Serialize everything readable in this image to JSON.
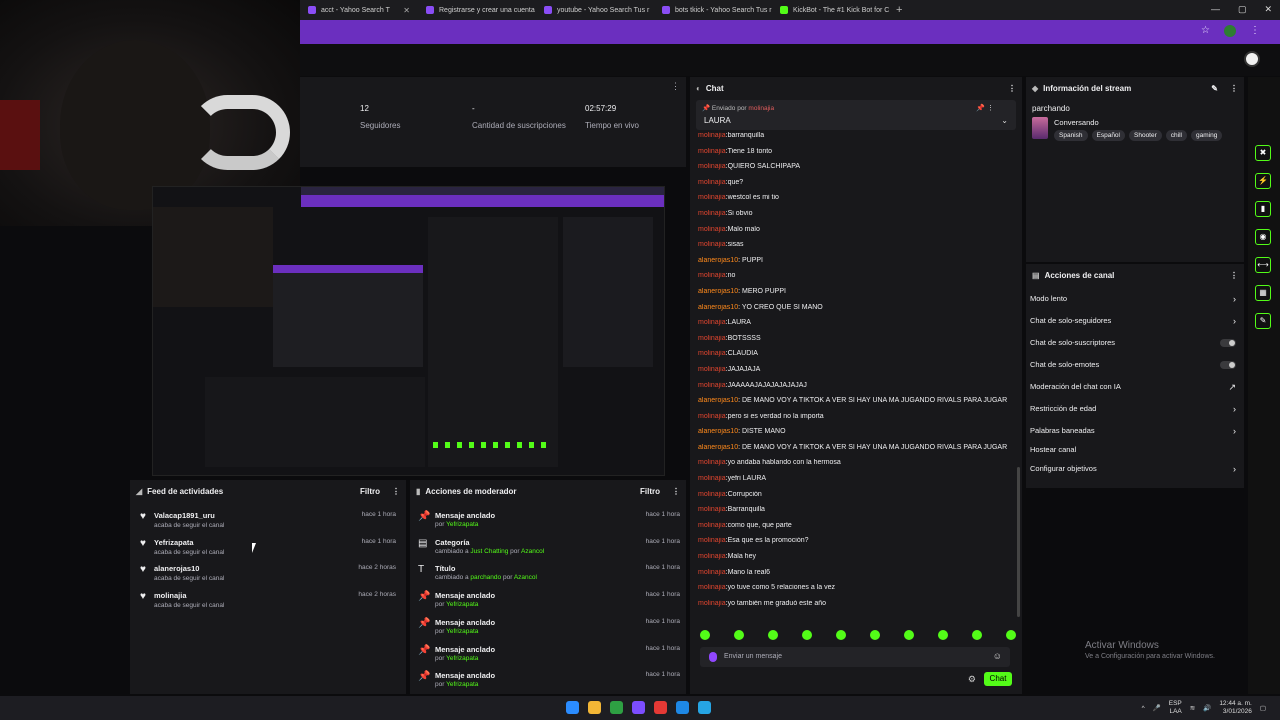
{
  "browser": {
    "tabs": [
      {
        "label": "acct - Yahoo Search T"
      },
      {
        "label": "Registrarse y crear una cuenta"
      },
      {
        "label": "youtube - Yahoo Search Tus r"
      },
      {
        "label": "bots tkick - Yahoo Search Tus r"
      },
      {
        "label": "KickBot - The #1 Kick Bot for C"
      }
    ],
    "new_tab": "+",
    "window_controls": [
      "—",
      "▢",
      "✕"
    ]
  },
  "stats": [
    {
      "value": "12",
      "label": "Seguidores"
    },
    {
      "value": "-",
      "label": "Cantidad de suscripciones"
    },
    {
      "value": "02:57:29",
      "label": "Tiempo en vivo"
    }
  ],
  "activity_feed": {
    "title": "Feed de actividades",
    "filter": "Filtro",
    "items": [
      {
        "name": "Valacap1891_uru",
        "sub": "acaba de seguir el canal",
        "time": "hace 1 hora"
      },
      {
        "name": "Yefrizapata",
        "sub": "acaba de seguir el canal",
        "time": "hace 1 hora"
      },
      {
        "name": "alanerojas10",
        "sub": "acaba de seguir el canal",
        "time": "hace 2 horas"
      },
      {
        "name": "molinajia",
        "sub": "acaba de seguir el canal",
        "time": "hace 2 horas"
      }
    ]
  },
  "mod_actions": {
    "title": "Acciones de moderador",
    "filter": "Filtro",
    "items": [
      {
        "icon": "pin-icon",
        "glyph": "📌",
        "name": "Mensaje anclado",
        "pre": "por ",
        "hl": "Yefrizapata",
        "mid": "",
        "hl2": "",
        "time": "hace 1 hora"
      },
      {
        "icon": "category-icon",
        "glyph": "▤",
        "name": "Categoría",
        "pre": "cambiado a ",
        "hl": "Just Chatting",
        "mid": " por ",
        "hl2": "Azancol",
        "time": "hace 1 hora"
      },
      {
        "icon": "title-icon",
        "glyph": "T",
        "name": "Título",
        "pre": "cambiado a ",
        "hl": "parchando",
        "mid": " por ",
        "hl2": "Azancol",
        "time": "hace 1 hora"
      },
      {
        "icon": "pin-icon",
        "glyph": "📌",
        "name": "Mensaje anclado",
        "pre": "por ",
        "hl": "Yefrizapata",
        "mid": "",
        "hl2": "",
        "time": "hace 1 hora"
      },
      {
        "icon": "pin-icon",
        "glyph": "📌",
        "name": "Mensaje anclado",
        "pre": "por ",
        "hl": "Yefrizapata",
        "mid": "",
        "hl2": "",
        "time": "hace 1 hora"
      },
      {
        "icon": "pin-icon",
        "glyph": "📌",
        "name": "Mensaje anclado",
        "pre": "por ",
        "hl": "Yefrizapata",
        "mid": "",
        "hl2": "",
        "time": "hace 1 hora"
      },
      {
        "icon": "pin-icon",
        "glyph": "📌",
        "name": "Mensaje anclado",
        "pre": "por ",
        "hl": "Yefrizapata",
        "mid": "",
        "hl2": "",
        "time": "hace 1 hora"
      }
    ]
  },
  "chat": {
    "title": "Chat",
    "pinned": {
      "by_prefix": "Enviado por",
      "by_user": "molinajia",
      "message": "LAURA"
    },
    "messages": [
      {
        "user": "molinajia",
        "text": ":barranquilla",
        "orange": false
      },
      {
        "user": "molinajia",
        "text": ":Tiene 18 tonto",
        "orange": false
      },
      {
        "user": "molinajia",
        "text": ":QUIERO SALCHIPAPA",
        "orange": false
      },
      {
        "user": "molinajia",
        "text": ":que?",
        "orange": false
      },
      {
        "user": "molinajia",
        "text": ":westcol es mi tio",
        "orange": false
      },
      {
        "user": "molinajia",
        "text": ":Si obvio",
        "orange": false
      },
      {
        "user": "molinajia",
        "text": ":Malo malo",
        "orange": false
      },
      {
        "user": "molinajia",
        "text": ":sisas",
        "orange": false
      },
      {
        "user": "alanerojas10",
        "text": ": PUPPI",
        "orange": true
      },
      {
        "user": "molinajia",
        "text": ":no",
        "orange": false
      },
      {
        "user": "alanerojas10",
        "text": ": MERO PUPPI",
        "orange": true
      },
      {
        "user": "alanerojas10",
        "text": ": YO CREO QUE SI MANO",
        "orange": true
      },
      {
        "user": "molinajia",
        "text": ":LAURA",
        "orange": false
      },
      {
        "user": "molinajia",
        "text": ":BOTSSSS",
        "orange": false
      },
      {
        "user": "molinajia",
        "text": ":CLAUDIA",
        "orange": false
      },
      {
        "user": "molinajia",
        "text": ":JAJAJAJA",
        "orange": false
      },
      {
        "user": "molinajia",
        "text": ":JAAAAAJAJAJAJAJAJAJ",
        "orange": false
      },
      {
        "user": "alanerojas10",
        "text": ": DE MANO VOY A TIKTOK A VER SI HAY UNA MA JUGANDO RIVALS PARA JUGAR",
        "orange": true
      },
      {
        "user": "molinajia",
        "text": ":pero si es verdad no la importa",
        "orange": false
      },
      {
        "user": "alanerojas10",
        "text": ": DISTE MANO",
        "orange": true
      },
      {
        "user": "alanerojas10",
        "text": ": DE MANO VOY A TIKTOK A VER SI HAY UNA MA JUGANDO RIVALS PARA JUGAR",
        "orange": true
      },
      {
        "user": "molinajia",
        "text": ":yo andaba hablando con la hermosa",
        "orange": false
      },
      {
        "user": "molinajia",
        "text": ":yefri LAURA",
        "orange": false
      },
      {
        "user": "molinajia",
        "text": ":Corrupción",
        "orange": false
      },
      {
        "user": "molinajia",
        "text": ":Barranquilla",
        "orange": false
      },
      {
        "user": "molinajia",
        "text": ":como que, que parte",
        "orange": false
      },
      {
        "user": "molinajia",
        "text": ":Esa que es la promoción?",
        "orange": false
      },
      {
        "user": "molinajia",
        "text": ":Mala hey",
        "orange": false
      },
      {
        "user": "molinajia",
        "text": ":Mano la real6",
        "orange": false
      },
      {
        "user": "molinajia",
        "text": ":yo tuve como 5 relaciones a la vez",
        "orange": false
      },
      {
        "user": "molinajia",
        "text": ":yo también me graduó este año",
        "orange": false
      }
    ],
    "input_placeholder": "Enviar un mensaje",
    "send_label": "Chat"
  },
  "stream_info": {
    "title": "Información del stream",
    "stream_title": "parchando",
    "category": "Conversando",
    "tags": [
      "Spanish",
      "Español",
      "Shooter",
      "chill",
      "gaming"
    ]
  },
  "channel_actions": {
    "title": "Acciones de canal",
    "items": [
      {
        "label": "Modo lento",
        "control": "chevron"
      },
      {
        "label": "Chat de solo-seguidores",
        "control": "chevron"
      },
      {
        "label": "Chat de solo-suscriptores",
        "control": "toggle"
      },
      {
        "label": "Chat de solo-emotes",
        "control": "toggle"
      },
      {
        "label": "Moderación del chat con IA",
        "control": "link"
      },
      {
        "label": "Restricción de edad",
        "control": "chevron"
      },
      {
        "label": "Palabras baneadas",
        "control": "chevron"
      },
      {
        "label": "Hostear canal",
        "control": "none"
      },
      {
        "label": "Configurar objetivos",
        "control": "chevron"
      }
    ]
  },
  "watermark": {
    "line1": "Activar Windows",
    "line2": "Ve a Configuración para activar Windows."
  },
  "taskbar": {
    "lang": "ESP",
    "region": "LAA",
    "time": "12:44 a. m.",
    "date": "3/01/2026"
  },
  "colors": {
    "accent": "#53fc18",
    "browser_purple": "#6b2fbf",
    "user_red": "#e0452f",
    "user_orange": "#ff8a1c"
  }
}
